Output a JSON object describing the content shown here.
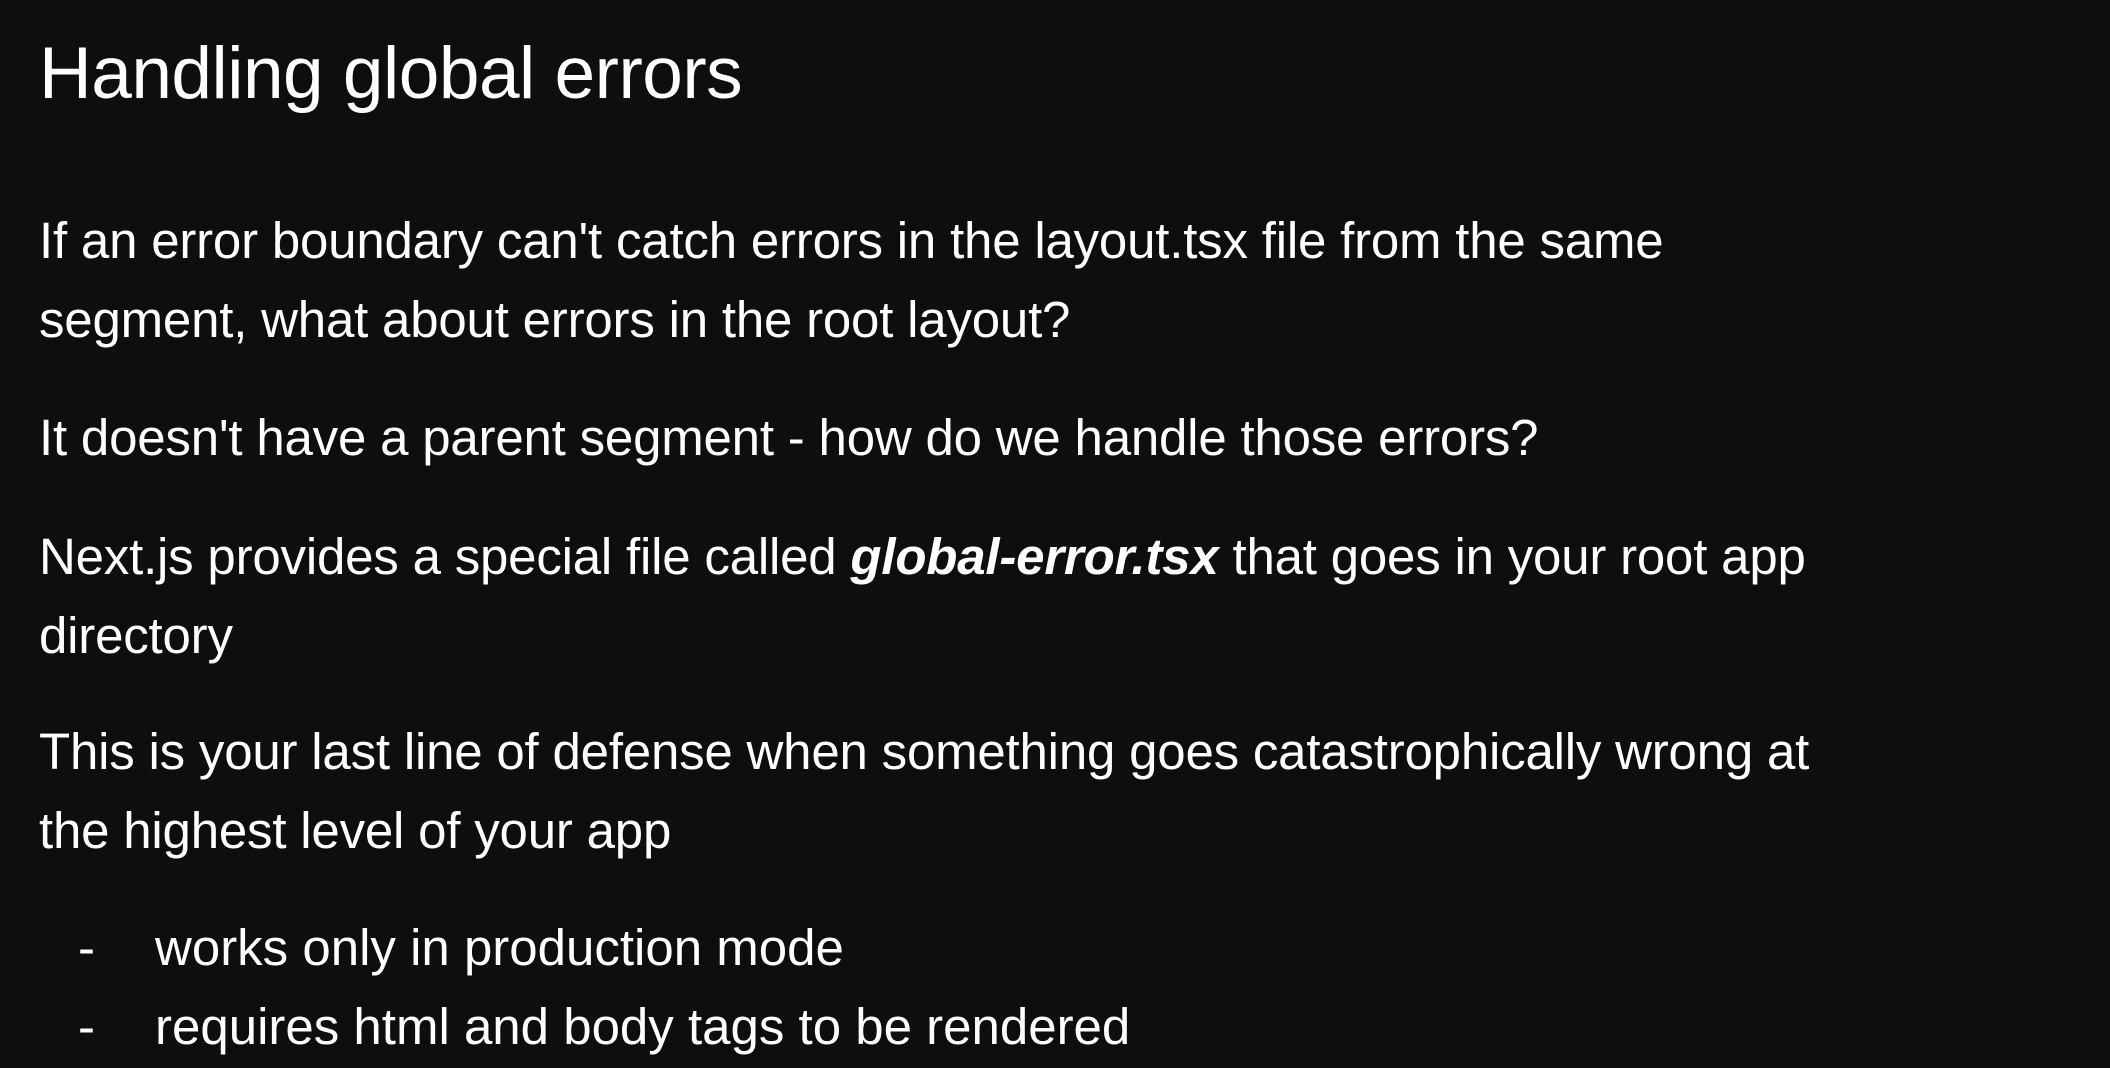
{
  "slide": {
    "title": "Handling global errors",
    "paragraphs": {
      "p1": {
        "line1": "If an error boundary can't catch errors in the layout.tsx file from the same",
        "line2": "segment, what about errors in the root layout?"
      },
      "p2": {
        "line1": "It doesn't have a parent segment - how do we handle those errors?"
      },
      "p3": {
        "line1_before": "Next.js provides a special file called ",
        "line1_emphasis": "global-error.tsx",
        "line1_after": " that goes in your root app",
        "line2": "directory"
      },
      "p4": {
        "line1": "This is your last line of defense when something goes catastrophically wrong at",
        "line2": "the highest level of your app"
      }
    },
    "bullets": [
      {
        "marker": "-",
        "text": "works only in production mode"
      },
      {
        "marker": "-",
        "text": "requires html and body tags to be rendered"
      }
    ]
  },
  "colors": {
    "background": "#0e0e0e",
    "text": "#ffffff"
  }
}
